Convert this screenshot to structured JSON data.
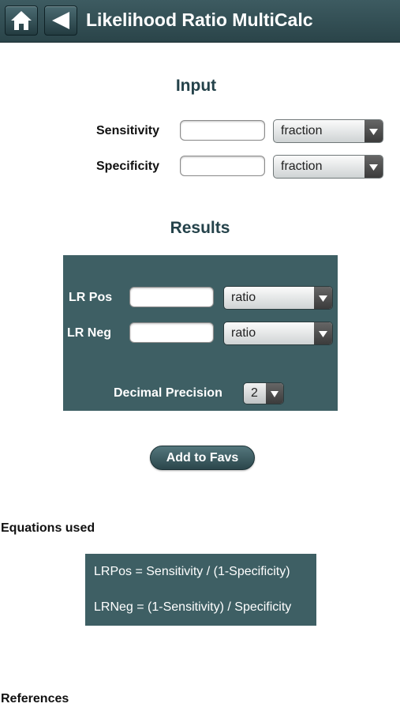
{
  "header": {
    "title": "Likelihood Ratio MultiCalc",
    "home_icon": "home-icon",
    "back_icon": "back-arrow-icon",
    "bar_color": "#2f4b51"
  },
  "input": {
    "heading": "Input",
    "sensitivity": {
      "label": "Sensitivity",
      "value": "",
      "unit": "fraction"
    },
    "specificity": {
      "label": "Specificity",
      "value": "",
      "unit": "fraction"
    }
  },
  "results": {
    "heading": "Results",
    "panel_color": "#3e5f64",
    "lr_pos": {
      "label": "LR Pos",
      "value": "",
      "unit": "ratio"
    },
    "lr_neg": {
      "label": "LR Neg",
      "value": "",
      "unit": "ratio"
    },
    "precision": {
      "label": "Decimal Precision",
      "value": "2"
    }
  },
  "actions": {
    "add_to_favs": "Add to Favs"
  },
  "equations": {
    "heading": "Equations used",
    "lines": [
      "LRPos = Sensitivity / (1-Specificity)",
      "LRNeg = (1-Sensitivity) / Specificity"
    ]
  },
  "references": {
    "heading": "References"
  }
}
